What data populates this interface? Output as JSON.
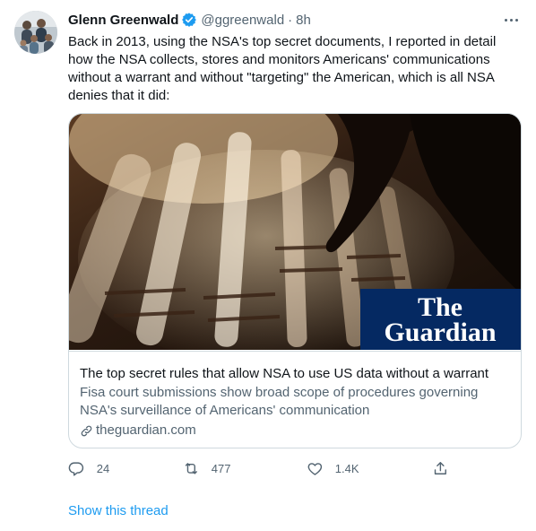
{
  "tweet": {
    "author_name": "Glenn Greenwald",
    "author_handle": "@ggreenwald",
    "separator": "·",
    "time": "8h",
    "verified_icon": "verified-badge-icon",
    "more_icon": "more-options-icon",
    "text": "Back in 2013, using the NSA's top secret documents, I reported in detail how the NSA collects, stores and monitors Americans' communications without a warrant and without \"targeting\" the American, which is all NSA denies that it did:"
  },
  "card": {
    "logo_line1": "The",
    "logo_line2": "Guardian",
    "title": "The top secret rules that allow NSA to use US data without a warrant",
    "description": "Fisa court submissions show broad scope of procedures governing NSA's surveillance of Americans' communication",
    "domain": "theguardian.com",
    "link_icon": "link-icon"
  },
  "actions": {
    "reply": {
      "icon": "reply-icon",
      "count": "24"
    },
    "retweet": {
      "icon": "retweet-icon",
      "count": "477"
    },
    "like": {
      "icon": "like-icon",
      "count": "1.4K"
    },
    "share": {
      "icon": "share-icon"
    }
  },
  "show_thread": "Show this thread",
  "colors": {
    "accent": "#1d9bf0",
    "text": "#0f1419",
    "secondary": "#536471",
    "border": "#cfd9de",
    "guardian_blue": "#052962"
  }
}
